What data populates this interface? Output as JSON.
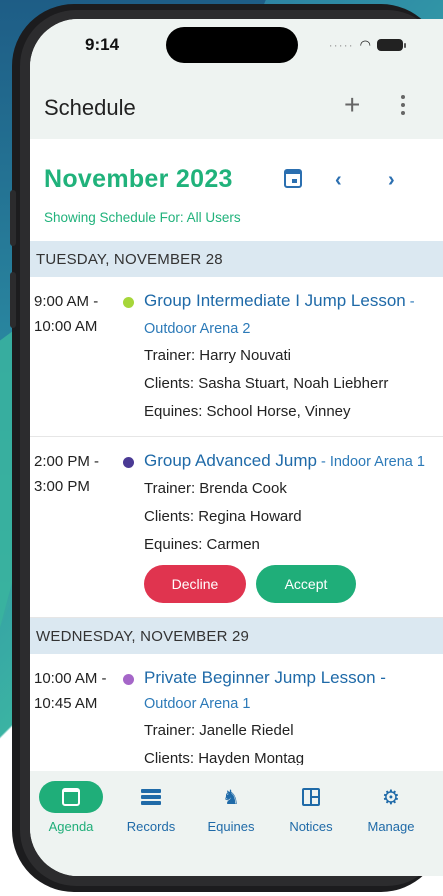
{
  "status_bar": {
    "time": "9:14"
  },
  "appbar": {
    "title": "Schedule"
  },
  "month": {
    "label": "November 2023",
    "prev": "‹",
    "next": "›"
  },
  "showing": "Showing Schedule For: All Users",
  "days": [
    {
      "header": "TUESDAY, NOVEMBER 28",
      "events": [
        {
          "start": "9:00 AM -",
          "end": "10:00 AM",
          "dot_color": "#a6d63a",
          "title": "Group Intermediate I Jump Lesson",
          "location": " - Outdoor Arena 2",
          "trainer_label": "Trainer:",
          "trainer": "Harry Nouvati",
          "clients_label": "Clients:",
          "clients": "Sasha Stuart, Noah Liebherr",
          "equines_label": "Equines:",
          "equines": "School Horse, Vinney"
        },
        {
          "start": "2:00 PM -",
          "end": "3:00 PM",
          "dot_color": "#4a3a94",
          "title": "Group Advanced Jump",
          "location": " - Indoor Arena 1",
          "trainer_label": "Trainer:",
          "trainer": "Brenda Cook",
          "clients_label": "Clients:",
          "clients": "Regina Howard",
          "equines_label": "Equines:",
          "equines": "Carmen",
          "decline": "Decline",
          "accept": "Accept"
        }
      ]
    },
    {
      "header": "WEDNESDAY, NOVEMBER 29",
      "events": [
        {
          "start": "10:00 AM -",
          "end": "10:45 AM",
          "dot_color": "#a566c8",
          "title": "Private Beginner Jump Lesson -",
          "location": "Outdoor Arena 1",
          "trainer_label": "Trainer:",
          "trainer": "Janelle Riedel",
          "clients_label": "Clients:",
          "clients": "Hayden Montag"
        }
      ]
    }
  ],
  "nav": {
    "agenda": "Agenda",
    "records": "Records",
    "equines": "Equines",
    "notices": "Notices",
    "manage": "Manage"
  },
  "colors": {
    "accent_green": "#1fae79",
    "link_blue": "#1f6aa8",
    "decline_red": "#e0344f"
  }
}
